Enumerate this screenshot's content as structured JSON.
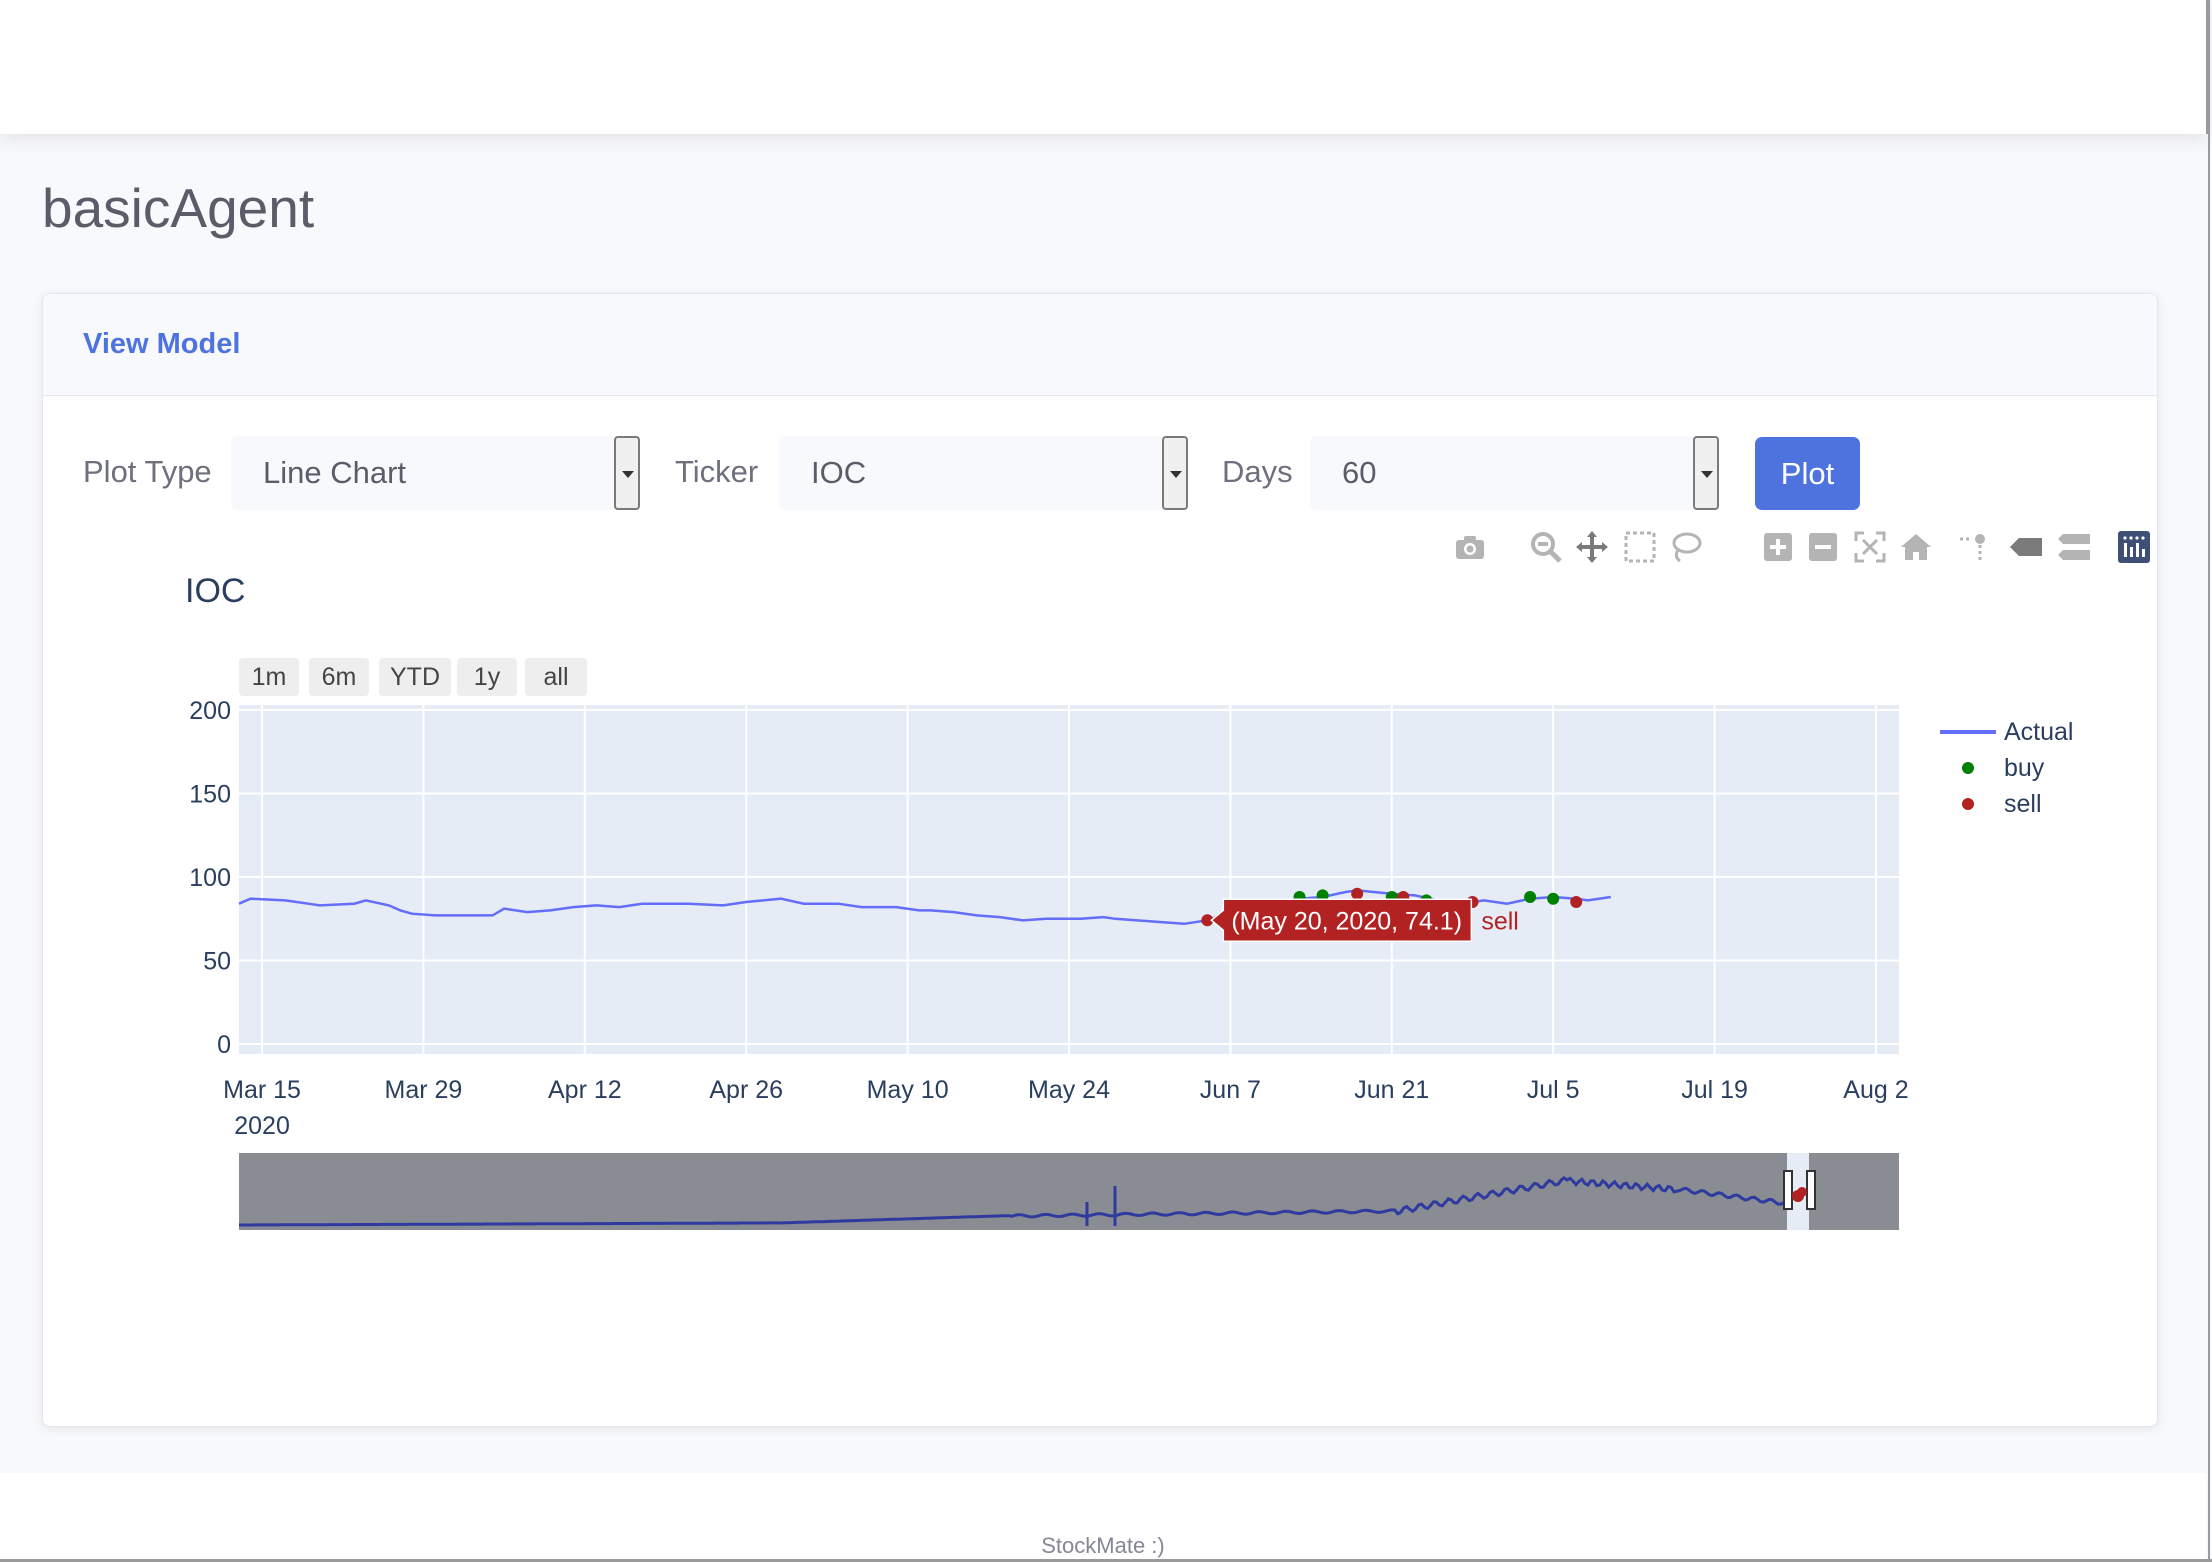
{
  "page": {
    "title": "basicAgent",
    "footer": "StockMate :)"
  },
  "card": {
    "header": "View Model"
  },
  "form": {
    "plot_type_label": "Plot Type",
    "plot_type_value": "Line Chart",
    "ticker_label": "Ticker",
    "ticker_value": "IOC",
    "days_label": "Days",
    "days_value": "60",
    "plot_button": "Plot"
  },
  "modebar": {
    "icons": [
      "camera-icon",
      "zoom-icon",
      "pan-icon",
      "box-select-icon",
      "lasso-select-icon",
      "zoom-in-icon",
      "zoom-out-icon",
      "autoscale-icon",
      "reset-axes-icon",
      "spike-lines-icon",
      "hover-closest-icon",
      "hover-compare-icon",
      "plotly-logo-icon"
    ]
  },
  "range_selector": [
    "1m",
    "6m",
    "YTD",
    "1y",
    "all"
  ],
  "colors": {
    "actual": "#636efa",
    "buy": "#008000",
    "sell": "#b22222",
    "accent": "#4e73df"
  },
  "chart_data": {
    "type": "line",
    "title": "IOC",
    "x_ticks": [
      "Mar 15",
      "Mar 29",
      "Apr 12",
      "Apr 26",
      "May 10",
      "May 24",
      "Jun 7",
      "Jun 21",
      "Jul 5",
      "Jul 19",
      "Aug 2"
    ],
    "x_tick_year": "2020",
    "x_range": [
      "2020-03-13",
      "2020-08-04"
    ],
    "y_ticks": [
      "0",
      "50",
      "100",
      "150",
      "200"
    ],
    "ylim": [
      0,
      200
    ],
    "grid": true,
    "legend_position": "right",
    "series": [
      {
        "name": "Actual",
        "mode": "line",
        "points": [
          [
            "2020-03-13",
            84
          ],
          [
            "2020-03-14",
            87
          ],
          [
            "2020-03-17",
            86
          ],
          [
            "2020-03-18",
            85
          ],
          [
            "2020-03-19",
            84
          ],
          [
            "2020-03-20",
            83
          ],
          [
            "2020-03-23",
            84
          ],
          [
            "2020-03-24",
            86
          ],
          [
            "2020-03-26",
            83
          ],
          [
            "2020-03-27",
            80
          ],
          [
            "2020-03-28",
            78
          ],
          [
            "2020-03-30",
            77
          ],
          [
            "2020-04-01",
            77
          ],
          [
            "2020-04-04",
            77
          ],
          [
            "2020-04-05",
            81
          ],
          [
            "2020-04-07",
            79
          ],
          [
            "2020-04-09",
            80
          ],
          [
            "2020-04-11",
            82
          ],
          [
            "2020-04-13",
            83
          ],
          [
            "2020-04-15",
            82
          ],
          [
            "2020-04-17",
            84
          ],
          [
            "2020-04-21",
            84
          ],
          [
            "2020-04-24",
            83
          ],
          [
            "2020-04-26",
            85
          ],
          [
            "2020-04-29",
            87
          ],
          [
            "2020-05-01",
            84
          ],
          [
            "2020-05-04",
            84
          ],
          [
            "2020-05-06",
            82
          ],
          [
            "2020-05-09",
            82
          ],
          [
            "2020-05-11",
            80
          ],
          [
            "2020-05-12",
            80
          ],
          [
            "2020-05-14",
            79
          ],
          [
            "2020-05-16",
            77
          ],
          [
            "2020-05-18",
            76
          ],
          [
            "2020-05-20",
            74
          ],
          [
            "2020-05-22",
            75
          ],
          [
            "2020-05-25",
            75
          ],
          [
            "2020-05-27",
            76
          ],
          [
            "2020-05-28",
            75
          ],
          [
            "2020-06-01",
            73
          ],
          [
            "2020-06-03",
            72
          ],
          [
            "2020-06-05",
            74.1
          ],
          [
            "2020-06-07",
            79
          ],
          [
            "2020-06-09",
            84
          ],
          [
            "2020-06-11",
            85
          ],
          [
            "2020-06-13",
            87
          ],
          [
            "2020-06-15",
            88
          ],
          [
            "2020-06-17",
            91
          ],
          [
            "2020-06-18",
            92
          ],
          [
            "2020-06-21",
            90
          ],
          [
            "2020-06-23",
            89
          ],
          [
            "2020-06-25",
            86
          ],
          [
            "2020-06-27",
            84
          ],
          [
            "2020-06-29",
            86
          ],
          [
            "2020-07-01",
            84
          ],
          [
            "2020-07-03",
            87
          ],
          [
            "2020-07-05",
            88
          ],
          [
            "2020-07-07",
            87
          ],
          [
            "2020-07-08",
            86
          ],
          [
            "2020-07-10",
            88
          ]
        ]
      },
      {
        "name": "buy",
        "mode": "markers",
        "points": [
          [
            "2020-06-13",
            88
          ],
          [
            "2020-06-15",
            89
          ],
          [
            "2020-06-21",
            88
          ],
          [
            "2020-06-24",
            86
          ],
          [
            "2020-07-03",
            88
          ],
          [
            "2020-07-05",
            87
          ]
        ]
      },
      {
        "name": "sell",
        "mode": "markers",
        "points": [
          [
            "2020-06-05",
            74.1
          ],
          [
            "2020-06-18",
            90
          ],
          [
            "2020-06-22",
            88
          ],
          [
            "2020-06-28",
            85
          ],
          [
            "2020-07-07",
            85
          ]
        ]
      }
    ],
    "hover": {
      "point": [
        "2020-06-05",
        74.1
      ],
      "text": "(May 20, 2020, 74.1)",
      "series": "sell"
    }
  }
}
